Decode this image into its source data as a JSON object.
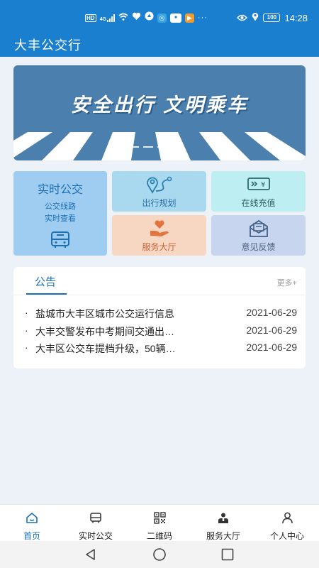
{
  "status_bar": {
    "network": "HD",
    "signal": "4G",
    "time": "14:28",
    "battery": "100"
  },
  "app": {
    "title": "大丰公交行"
  },
  "banner": {
    "slogan": "安全出行 文明乘车"
  },
  "tiles": {
    "realtime_bus": {
      "title": "实时公交",
      "line1": "公交线路",
      "line2": "实时查看"
    },
    "trip_plan": "出行规划",
    "online_topup": "在线充值",
    "service_hall": "服务大厅",
    "feedback": "意见反馈",
    "currency_symbol": "¥"
  },
  "notice": {
    "tab_label": "公告",
    "more_label": "更多+",
    "items": [
      {
        "title": "盐城市大丰区城市公交运行信息",
        "date": "2021-06-29"
      },
      {
        "title": "大丰交警发布中考期间交通出…",
        "date": "2021-06-29"
      },
      {
        "title": "大丰区公交车提档升级，50辆…",
        "date": "2021-06-29"
      }
    ]
  },
  "tabbar": {
    "items": [
      {
        "label": "首页",
        "icon": "home-icon",
        "active": true
      },
      {
        "label": "实时公交",
        "icon": "bus-icon",
        "active": false
      },
      {
        "label": "二维码",
        "icon": "qrcode-icon",
        "active": false
      },
      {
        "label": "服务大厅",
        "icon": "service-icon",
        "active": false
      },
      {
        "label": "个人中心",
        "icon": "user-icon",
        "active": false
      }
    ]
  },
  "colors": {
    "brand": "#1b7fd0",
    "accent_text": "#1b6fb8",
    "banner_bg": "#4b7fae"
  }
}
